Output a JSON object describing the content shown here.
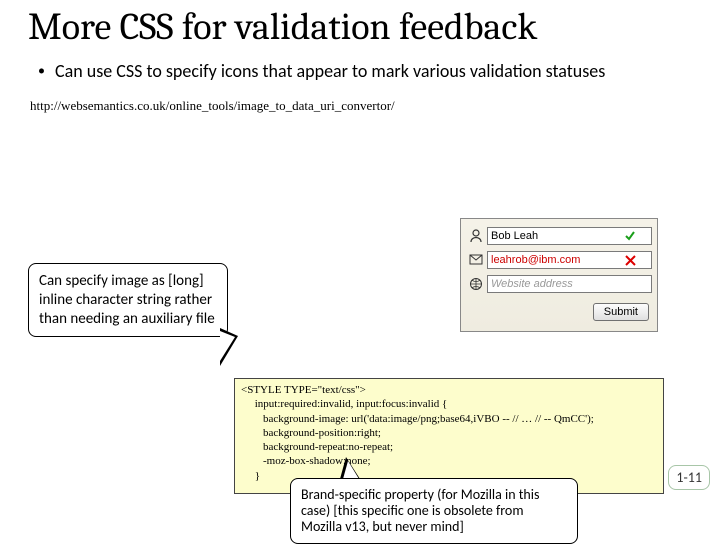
{
  "title": "More CSS for validation feedback",
  "bullet": "Can use CSS to specify icons that appear to mark various validation statuses",
  "url": "http://websemantics.co.uk/online_tools/image_to_data_uri_convertor/",
  "callout1": "Can specify image as [long] inline character string rather than needing an auxiliary file",
  "callout2": "Brand-specific property (for Mozilla in this case) [this specific one is obsolete from Mozilla v13, but never mind]",
  "form": {
    "name_value": "Bob Leah",
    "email_value": "leahrob@ibm.com",
    "website_placeholder": "Website address",
    "submit_label": "Submit"
  },
  "code": "<STYLE TYPE=\"text/css\">\n     input:required:invalid, input:focus:invalid {\n        background-image: url('data:image/png;base64,iVBO -- // … // -- QmCC');\n        background-position:right;\n        background-repeat:no-repeat;\n        -moz-box-shadow:none;\n     }",
  "page_number": "1-11"
}
